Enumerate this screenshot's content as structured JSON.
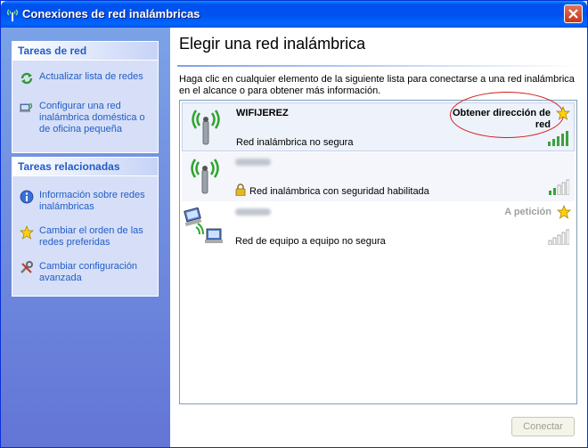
{
  "window": {
    "title": "Conexiones de red inalámbricas"
  },
  "sidebar": {
    "network_tasks": {
      "header": "Tareas de red",
      "items": [
        {
          "label": "Actualizar lista de redes",
          "icon": "refresh-icon"
        },
        {
          "label": "Configurar una red inalámbrica doméstica o de oficina pequeña",
          "icon": "network-setup-icon"
        }
      ]
    },
    "related_tasks": {
      "header": "Tareas relacionadas",
      "items": [
        {
          "label": "Información sobre redes inalámbricas",
          "icon": "info-icon"
        },
        {
          "label": "Cambiar el orden de las redes preferidas",
          "icon": "star-icon"
        },
        {
          "label": "Cambiar configuración avanzada",
          "icon": "settings-tools-icon"
        }
      ]
    }
  },
  "main": {
    "title": "Elegir una red inalámbrica",
    "description": "Haga clic en cualquier elemento de la siguiente lista para conectarse a una red inalámbrica en el alcance o para obtener más información.",
    "networks": [
      {
        "name": "WIFIJEREZ",
        "type": "Red inalámbrica no segura",
        "status": "Obtener dirección de red",
        "signal_bars": 5,
        "secured": false,
        "preferred": true,
        "selected": true
      },
      {
        "name": "",
        "type": "Red inalámbrica con seguridad habilitada",
        "status": "",
        "signal_bars": 2,
        "secured": true,
        "preferred": false,
        "selected": false
      },
      {
        "name": "",
        "type": "Red de equipo a equipo no segura",
        "status": "A petición",
        "signal_bars": 0,
        "secured": false,
        "preferred": true,
        "selected": false
      }
    ],
    "connect_button": "Conectar"
  },
  "colors": {
    "title_bar": "#0053ee",
    "sidebar": "#7ba2e7",
    "link": "#215dc6",
    "signal_on": "#3ca13c",
    "annotation": "#d0201c"
  }
}
